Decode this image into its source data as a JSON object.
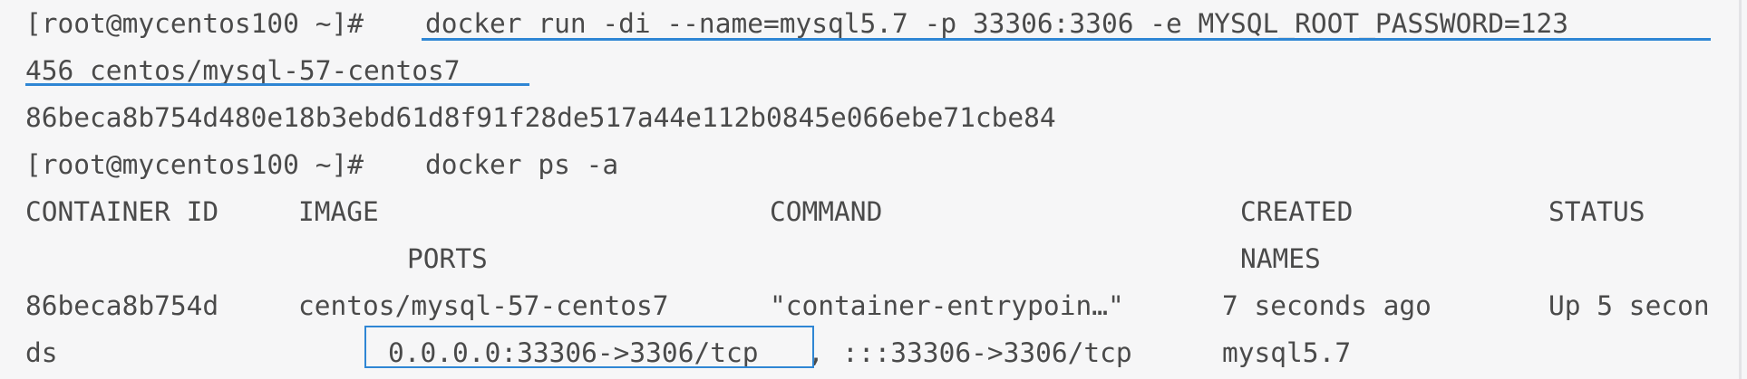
{
  "terminal": {
    "prompt": "[root@mycentos100 ~]#",
    "run_command_part1": "docker run -di --name=mysql5.7 -p 33306:3306 -e MYSQL_ROOT_PASSWORD=123",
    "run_command_part2": "456 centos/mysql-57-centos7",
    "container_hash": "86beca8b754d480e18b3ebd61d8f91f28de517a44e112b0845e066ebe71cbe84",
    "ps_command": "docker ps -a",
    "headers": {
      "container_id": "CONTAINER ID",
      "image": "IMAGE",
      "command": "COMMAND",
      "created": "CREATED",
      "status": "STATUS",
      "ports": "PORTS",
      "names": "NAMES"
    },
    "row": {
      "container_id": "86beca8b754d",
      "image": "centos/mysql-57-centos7",
      "command": "\"container-entrypoin…\"",
      "created": "7 seconds ago",
      "status_part1": "Up 5 secon",
      "status_part2": "ds",
      "port_ipv4": "0.0.0.0:33306->3306/tcp",
      "port_separator": ",",
      "port_ipv6": ":::33306->3306/tcp",
      "names": "mysql5.7"
    },
    "colors": {
      "background": "#f6f6f7",
      "text": "#4a4a4a",
      "annotation": "#2f86d4"
    }
  }
}
